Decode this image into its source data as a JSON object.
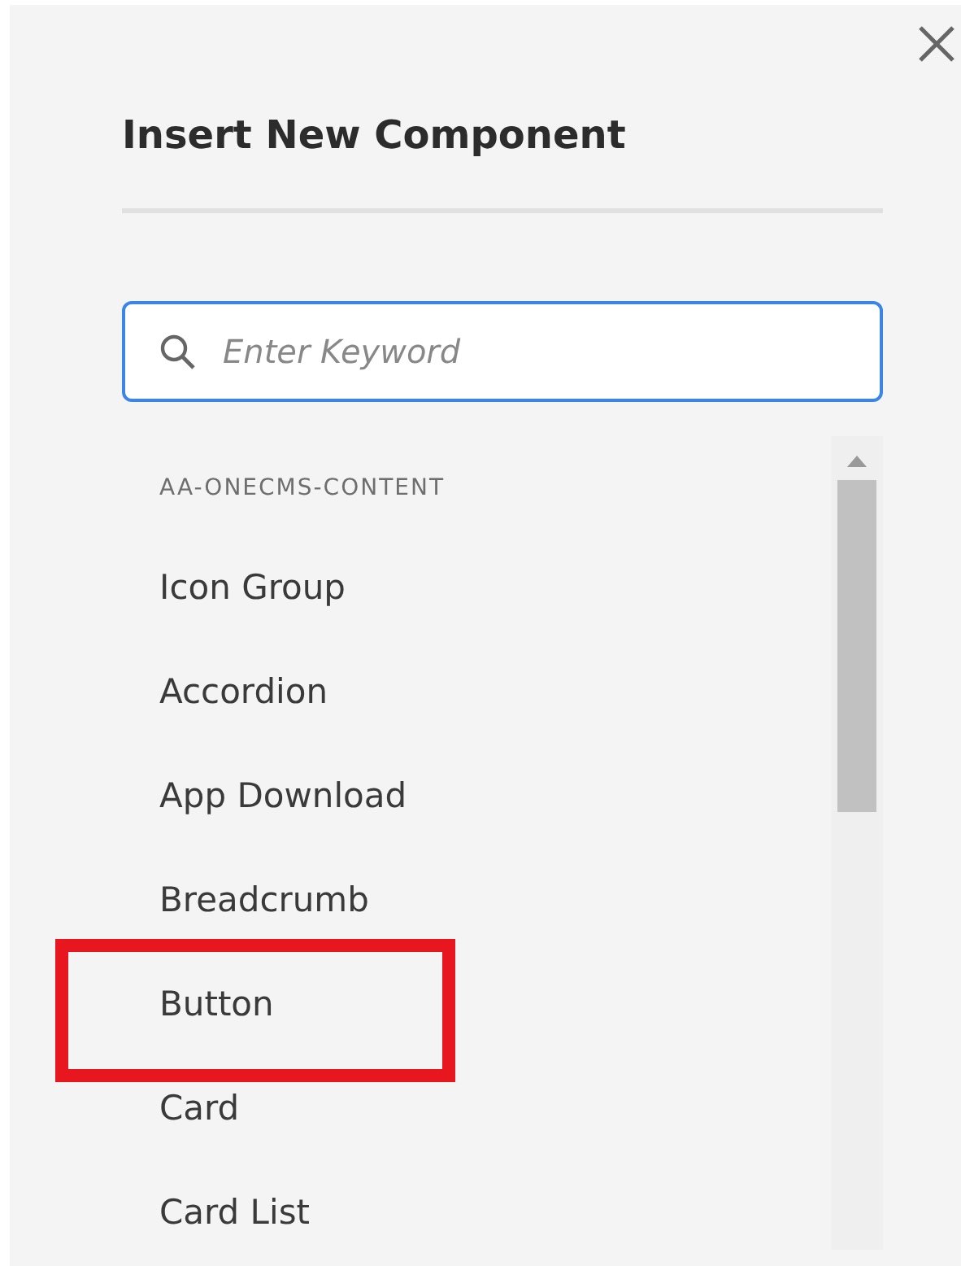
{
  "dialog": {
    "title": "Insert New Component"
  },
  "search": {
    "placeholder": "Enter Keyword"
  },
  "groups": [
    {
      "label": "AA-ONECMS-CONTENT",
      "items": [
        {
          "label": "Icon Group",
          "highlighted": false
        },
        {
          "label": "Accordion",
          "highlighted": false
        },
        {
          "label": "App Download",
          "highlighted": false
        },
        {
          "label": "Breadcrumb",
          "highlighted": false
        },
        {
          "label": "Button",
          "highlighted": true
        },
        {
          "label": "Card",
          "highlighted": false
        },
        {
          "label": "Card List",
          "highlighted": false
        }
      ]
    }
  ]
}
